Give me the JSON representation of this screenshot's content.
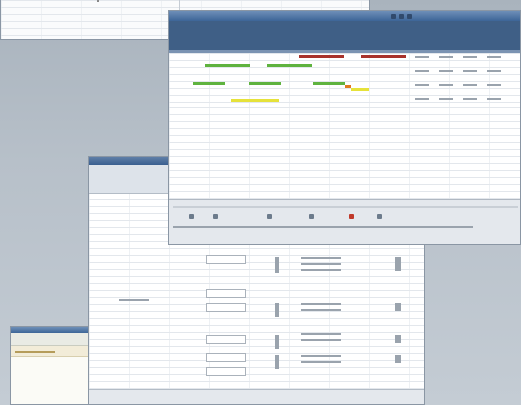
{
  "colors": {
    "desktop": "#b7c0c9",
    "titlebar": "#3a5f8f",
    "bar_red": "#a8322b",
    "bar_green": "#5fb33f",
    "bar_yellow": "#e6e23a",
    "bar_orange": "#e07a1e"
  },
  "windows": [
    {
      "name": "top-left-window",
      "title": ""
    },
    {
      "name": "gantt-window",
      "title": ""
    },
    {
      "name": "list-window",
      "title": ""
    },
    {
      "name": "small-window",
      "title": ""
    }
  ]
}
